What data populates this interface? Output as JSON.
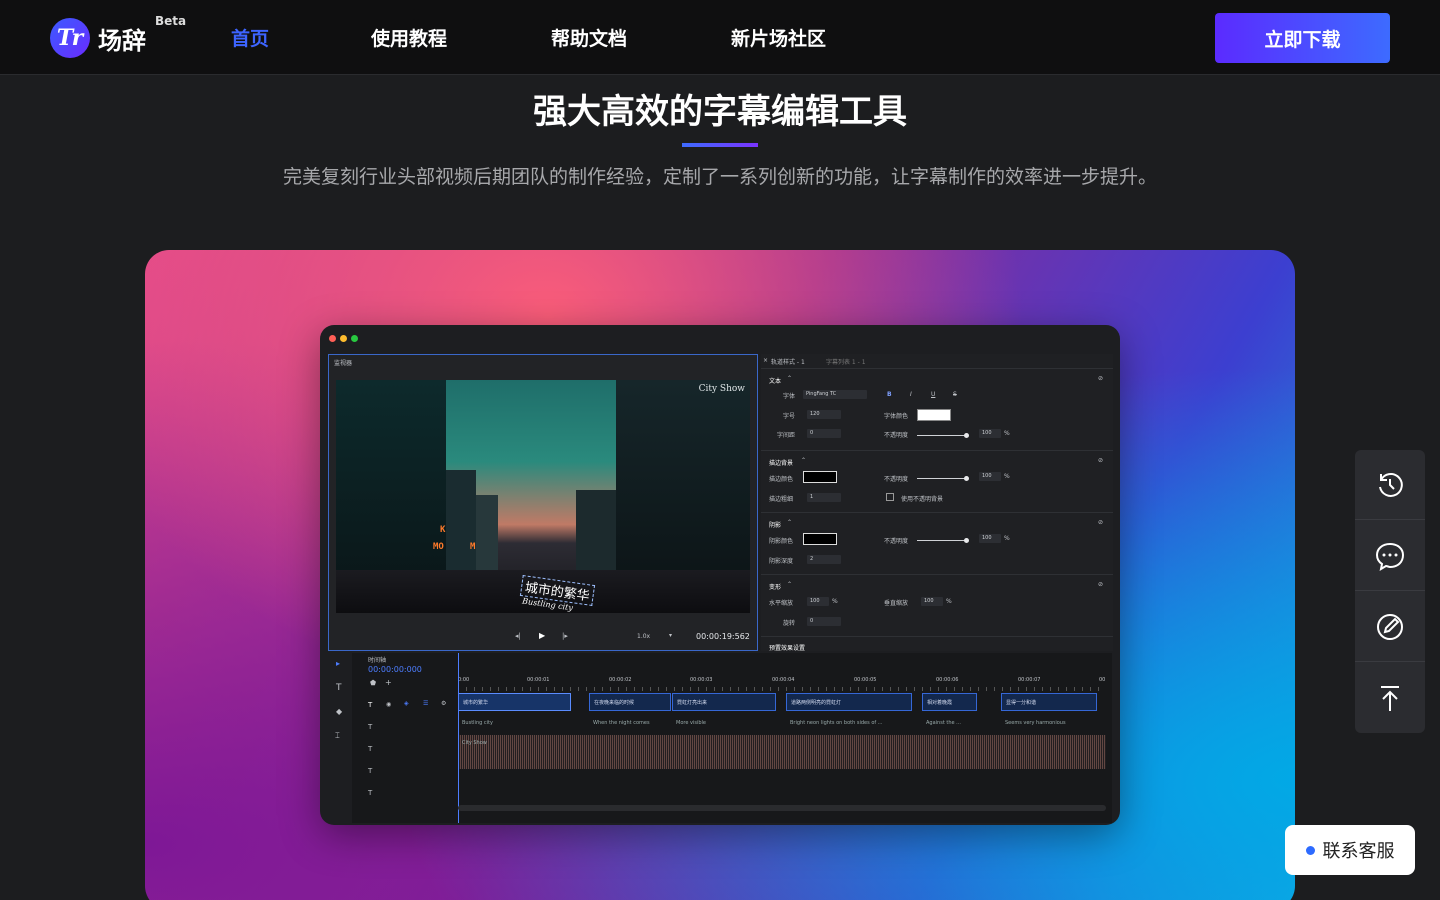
{
  "header": {
    "logo_mark": "Tr",
    "logo_name": "场辞",
    "logo_beta": "Beta",
    "nav": [
      "首页",
      "使用教程",
      "帮助文档",
      "新片场社区"
    ],
    "download": "立即下载"
  },
  "hero": {
    "title": "强大高效的字幕编辑工具",
    "subtitle": "完美复刻行业头部视频后期团队的制作经验，定制了一系列创新的功能，让字幕制作的效率进一步提升。"
  },
  "app": {
    "preview_label": "监视器",
    "video": {
      "watermark": "City Show",
      "subtitle_cn": "城市的繁华",
      "subtitle_en": "Bustling city",
      "sign_1": "MO",
      "sign_2": "M",
      "sign_3": "K"
    },
    "player": {
      "speed": "1.0x",
      "time": "00:00:19:562"
    },
    "props": {
      "tab_1": "轨道样式 - 1",
      "tab_2": "字幕列表 1 - 1",
      "sections": {
        "text": "文本",
        "stroke": "描边背景",
        "shadow": "阴影",
        "transform": "变形",
        "preset": "预置效果设置"
      },
      "labels": {
        "font": "字体",
        "size": "字号",
        "spacing": "字间距",
        "font_color": "字体颜色",
        "opacity": "不透明度",
        "stroke_color": "描边颜色",
        "stroke_width": "描边粗细",
        "use_bg": "使用不透明背景",
        "shadow_color": "阴影颜色",
        "shadow_depth": "阴影深度",
        "h_scale": "水平缩放",
        "v_scale": "垂直缩放",
        "rotate": "旋转"
      },
      "values": {
        "font": "PingFang TC",
        "size": "120",
        "spacing": "0",
        "opacity": "100",
        "stroke_width": "1",
        "shadow_depth": "2",
        "h_scale": "100",
        "v_scale": "100",
        "rotate": "0",
        "percent": "%"
      },
      "format_buttons": [
        "B",
        "I",
        "U",
        "S"
      ]
    },
    "timeline": {
      "label": "时间轴",
      "timecode": "00:00:00:000",
      "ruler": [
        "0:00",
        "00:00:01",
        "00:00:02",
        "00:00:03",
        "00:00:04",
        "00:00:05",
        "00:00:06",
        "00:00:07",
        "00"
      ],
      "clips_cn": [
        "城市的繁华",
        "在夜晚来临的时候",
        "霓虹灯亮出来",
        "道路两侧明亮的霓虹灯",
        "相对着晚霞",
        "显得一分和谐"
      ],
      "clips_en": [
        "Bustling city",
        "When the night comes",
        "More visible",
        "Bright neon lights on both sides of ...",
        "Against the ...",
        "Seems very harmonious"
      ],
      "track_3": "City Show"
    }
  },
  "contact": "联系客服",
  "colors": {
    "accent": "#3d64ff",
    "header_bg": "#0f0f10",
    "page_bg": "#1c1d1f"
  }
}
